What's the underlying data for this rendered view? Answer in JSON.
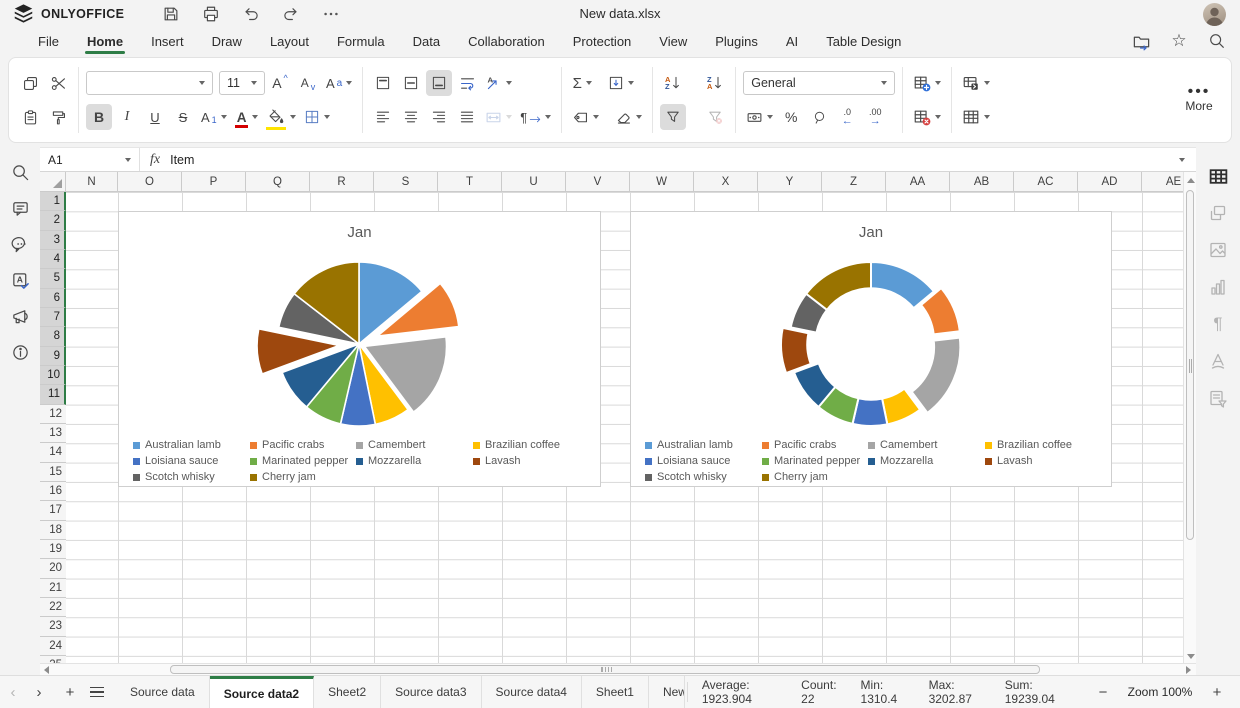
{
  "app": {
    "brand": "ONLYOFFICE",
    "title": "New data.xlsx"
  },
  "icons": {
    "star": "☆",
    "sum": "Σ",
    "percent": "%",
    "paragraph": "¶",
    "more_dots": "•••",
    "nav_left": "‹",
    "nav_right": "›",
    "plus": "+",
    "minus": "−",
    "font_inc": "A",
    "font_dec": "A",
    "change_case": "Aa",
    "subscript_a": "A",
    "subscript_1": "1"
  },
  "menubar": {
    "tabs": [
      {
        "label": "File",
        "active": false
      },
      {
        "label": "Home",
        "active": true
      },
      {
        "label": "Insert",
        "active": false
      },
      {
        "label": "Draw",
        "active": false
      },
      {
        "label": "Layout",
        "active": false
      },
      {
        "label": "Formula",
        "active": false
      },
      {
        "label": "Data",
        "active": false
      },
      {
        "label": "Collaboration",
        "active": false
      },
      {
        "label": "Protection",
        "active": false
      },
      {
        "label": "View",
        "active": false
      },
      {
        "label": "Plugins",
        "active": false
      },
      {
        "label": "AI",
        "active": false
      },
      {
        "label": "Table Design",
        "active": false
      }
    ]
  },
  "ribbon": {
    "font_name": "",
    "font_size": "11",
    "number_format": "General",
    "more_label": "More",
    "bold": "B",
    "italic": "I",
    "underline": "U",
    "strike": "S",
    "dec_decimal": ".0",
    "inc_decimal": ".00",
    "sort_az": [
      "A",
      "Z"
    ],
    "sort_za": [
      "Z",
      "A"
    ],
    "arrow_down": "↓",
    "arrow_left": "←",
    "arrow_right": "→"
  },
  "formula_bar": {
    "cell_ref": "A1",
    "fx": "fx",
    "value": "Item"
  },
  "grid": {
    "columns": [
      "N",
      "O",
      "P",
      "Q",
      "R",
      "S",
      "T",
      "U",
      "V",
      "W",
      "X",
      "Y",
      "Z",
      "AA",
      "AB",
      "AC",
      "AD",
      "AE"
    ],
    "rows": [
      "1",
      "2",
      "3",
      "4",
      "5",
      "6",
      "7",
      "8",
      "9",
      "10",
      "11",
      "12",
      "13",
      "14",
      "15",
      "16",
      "17",
      "18",
      "19",
      "20",
      "21",
      "22",
      "23",
      "24",
      "25"
    ],
    "highlighted_rows_from": 1,
    "highlighted_rows_to": 11
  },
  "chart_data": [
    {
      "type": "pie",
      "title": "Jan",
      "categories": [
        "Australian lamb",
        "Pacific crabs",
        "Camembert",
        "Brazilian coffee",
        "Loisiana sauce",
        "Marinated pepper",
        "Mozzarella",
        "Lavash",
        "Scotch whisky",
        "Cherry jam"
      ],
      "values": [
        2674.2,
        1778.5,
        3202.87,
        1350,
        1310.4,
        1430.2,
        1597.8,
        1712.3,
        1392.5,
        2790.27
      ],
      "values_estimated_from_angles": true,
      "sum": 19239.04,
      "colors": [
        "#5B9BD5",
        "#ED7D31",
        "#A5A5A5",
        "#FFC000",
        "#4472C4",
        "#70AD47",
        "#255E91",
        "#9E480E",
        "#636363",
        "#997300"
      ],
      "legend_position": "bottom",
      "explode": {
        "Pacific crabs": 20,
        "Camembert": 6,
        "Lavash": 20
      }
    },
    {
      "type": "doughnut",
      "title": "Jan",
      "categories": [
        "Australian lamb",
        "Pacific crabs",
        "Camembert",
        "Brazilian coffee",
        "Loisiana sauce",
        "Marinated pepper",
        "Mozzarella",
        "Lavash",
        "Scotch whisky",
        "Cherry jam"
      ],
      "values": [
        2674.2,
        1778.5,
        3202.87,
        1350,
        1310.4,
        1430.2,
        1597.8,
        1712.3,
        1392.5,
        2790.27
      ],
      "values_estimated_from_angles": true,
      "sum": 19239.04,
      "colors": [
        "#5B9BD5",
        "#ED7D31",
        "#A5A5A5",
        "#FFC000",
        "#4472C4",
        "#70AD47",
        "#255E91",
        "#9E480E",
        "#636363",
        "#997300"
      ],
      "legend_position": "bottom",
      "inner_radius_ratio": 0.68,
      "explode": {
        "Pacific crabs": 8,
        "Camembert": 8,
        "Lavash": 8
      }
    }
  ],
  "sheet_bar": {
    "tabs": [
      {
        "label": "Source data",
        "active": false
      },
      {
        "label": "Source data2",
        "active": true
      },
      {
        "label": "Sheet2",
        "active": false
      },
      {
        "label": "Source data3",
        "active": false
      },
      {
        "label": "Source data4",
        "active": false
      },
      {
        "label": "Sheet1",
        "active": false
      },
      {
        "label": "New",
        "active": false,
        "clipped": true
      }
    ]
  },
  "status_bar": {
    "stats": [
      "Average: 1923.904",
      "Count: 22",
      "Min: 1310.4",
      "Max: 3202.87",
      "Sum: 19239.04"
    ],
    "zoom_label": "Zoom 100%"
  }
}
